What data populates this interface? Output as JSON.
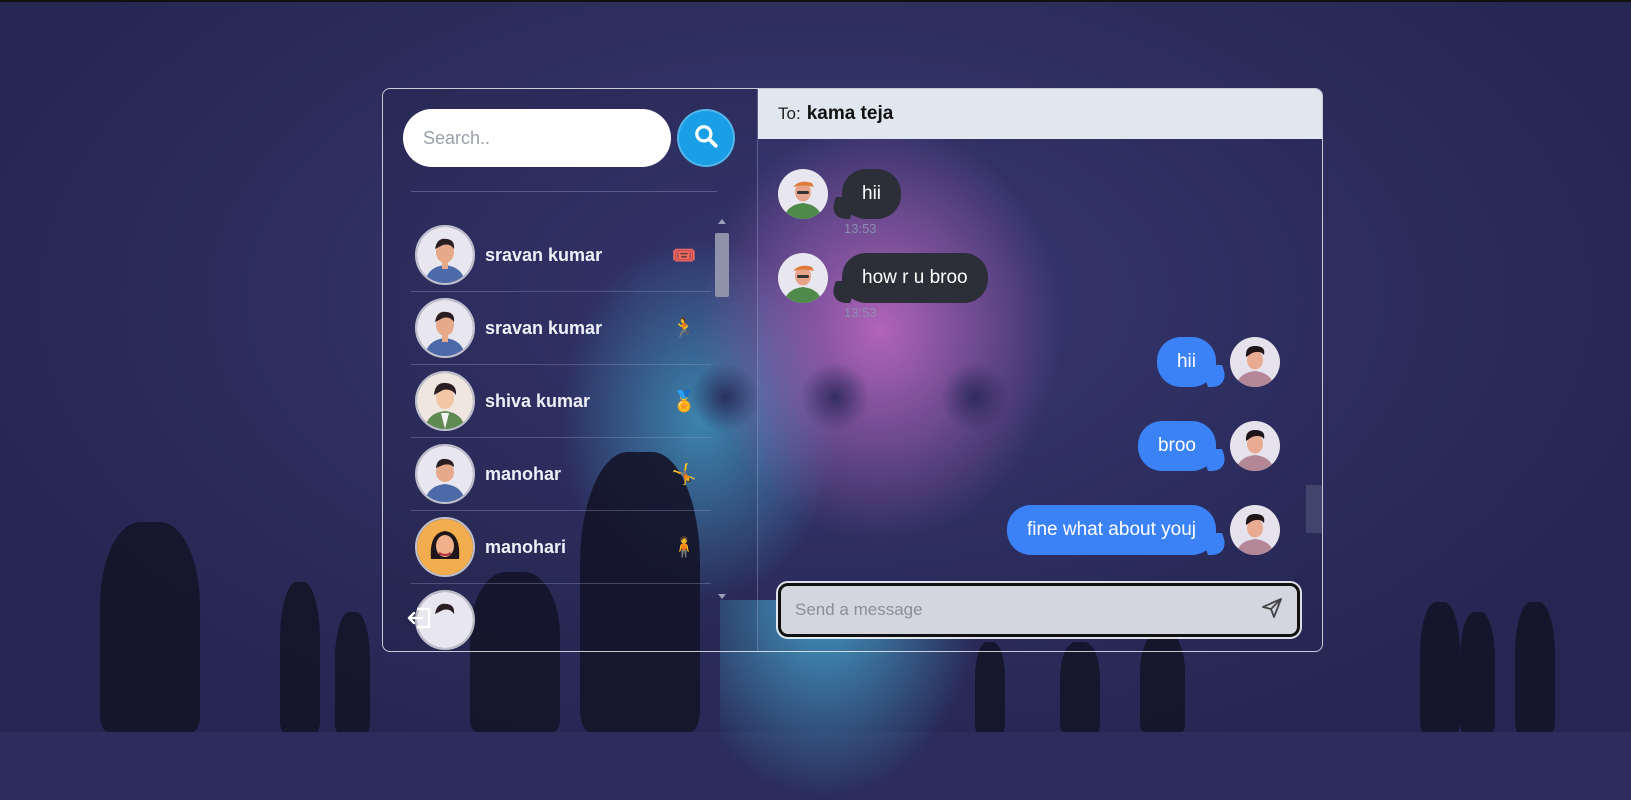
{
  "search": {
    "placeholder": "Search.."
  },
  "contacts": [
    {
      "name": "sravan kumar",
      "badge": "🎟️",
      "avatar_color": "#4c6aa8"
    },
    {
      "name": "sravan kumar",
      "badge": "🏃",
      "avatar_color": "#4c6aa8"
    },
    {
      "name": "shiva kumar",
      "badge": "🏅",
      "avatar_color": "#5f8a52"
    },
    {
      "name": "manohar",
      "badge": "🤸",
      "avatar_color": "#4c6aa8"
    },
    {
      "name": "manohari",
      "badge": "🧍",
      "avatar_color": "#f1ad4e"
    }
  ],
  "chat": {
    "to_label": "To:",
    "recipient": "kama teja",
    "messages": [
      {
        "direction": "incoming",
        "text": "hii",
        "time": "13:53"
      },
      {
        "direction": "incoming",
        "text": "how r u broo",
        "time": "13:53"
      },
      {
        "direction": "outgoing",
        "text": "hii"
      },
      {
        "direction": "outgoing",
        "text": "broo"
      },
      {
        "direction": "outgoing",
        "text": "fine what about youj"
      }
    ]
  },
  "composer": {
    "placeholder": "Send a message"
  },
  "icons": {
    "search": "search-icon",
    "send": "send-icon",
    "logout": "logout-icon"
  },
  "colors": {
    "accent": "#1a9ee6",
    "outgoing_bubble": "#3b82f6",
    "incoming_bubble": "#2c2f38",
    "header_bg": "#e1e7ef"
  }
}
